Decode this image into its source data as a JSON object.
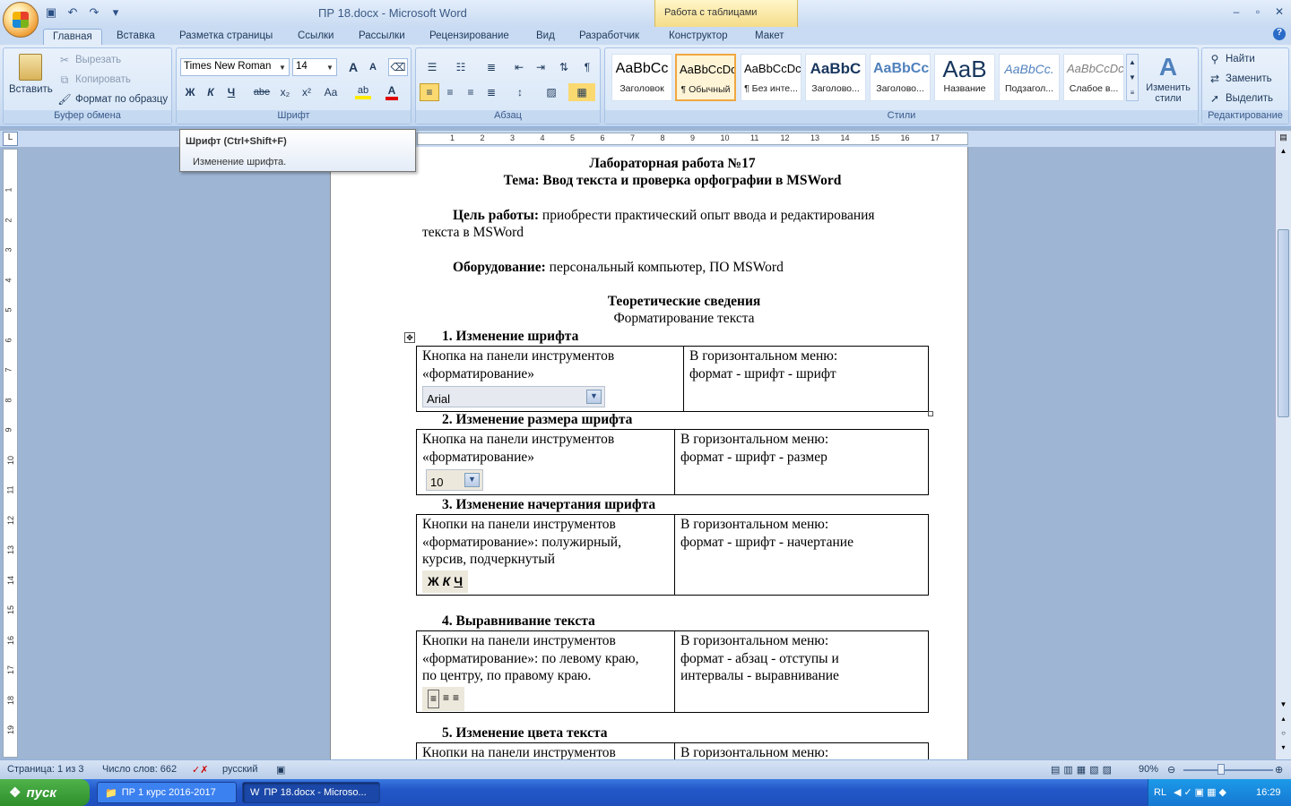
{
  "window": {
    "title": "ПР 18.docx - Microsoft Word",
    "context_tab": "Работа с таблицами"
  },
  "qat": {
    "save": "save-icon",
    "undo": "↶",
    "redo": "↷"
  },
  "tabs": [
    "Главная",
    "Вставка",
    "Разметка страницы",
    "Ссылки",
    "Рассылки",
    "Рецензирование",
    "Вид",
    "Разработчик",
    "Конструктор",
    "Макет"
  ],
  "clipboard": {
    "paste": "Вставить",
    "cut": "Вырезать",
    "copy": "Копировать",
    "format_painter": "Формат по образцу",
    "label": "Буфер обмена"
  },
  "font": {
    "family": "Times New Roman",
    "size": "14",
    "label": "Шрифт",
    "bold": "Ж",
    "italic": "К",
    "underline": "Ч",
    "strike": "abe",
    "sub": "x₂",
    "sup": "x²",
    "case": "Aa",
    "grow": "A",
    "shrink": "A"
  },
  "paragraph": {
    "label": "Абзац"
  },
  "styles": {
    "label": "Стили",
    "items": [
      {
        "preview": "AaBbCc",
        "name": "Заголовок"
      },
      {
        "preview": "AaBbCcDc",
        "name": "¶ Обычный"
      },
      {
        "preview": "AaBbCcDc",
        "name": "¶ Без инте..."
      },
      {
        "preview": "AaBbC",
        "name": "Заголово..."
      },
      {
        "preview": "AaBbCc",
        "name": "Заголово..."
      },
      {
        "preview": "AaB",
        "name": "Название"
      },
      {
        "preview": "AaBbCc.",
        "name": "Подзагол..."
      },
      {
        "preview": "AaBbCcDc",
        "name": "Слабое в..."
      }
    ],
    "change": "Изменить стили"
  },
  "editing": {
    "find": "Найти",
    "replace": "Заменить",
    "select": "Выделить",
    "label": "Редактирование"
  },
  "tooltip": {
    "title": "Шрифт (Ctrl+Shift+F)",
    "desc": "Изменение шрифта."
  },
  "ruler": {
    "marks": [
      "1",
      "2",
      "3",
      "4",
      "5",
      "6",
      "7",
      "8",
      "9",
      "10",
      "11",
      "12",
      "13",
      "14",
      "15",
      "16",
      "17"
    ],
    "vmarks": [
      "1",
      "2",
      "3",
      "4",
      "5",
      "6",
      "7",
      "8",
      "9",
      "10",
      "11",
      "12",
      "13",
      "14",
      "15",
      "16",
      "17",
      "18",
      "19"
    ]
  },
  "doc": {
    "title1": "Лабораторная работа №17",
    "title2": "Тема: Ввод текста и проверка орфографии в MSWord",
    "goal_label": "Цель работы:",
    "goal_text1": " приобрести практический опыт ввода и редактирования",
    "goal_text2": "текста в MSWord",
    "equip_label": "Оборудование:",
    "equip_text": " персональный компьютер, ПО MSWord",
    "theory": "Теоретические сведения",
    "formatting": "Форматирование текста",
    "s1": "1.  Изменение шрифта",
    "s2": "2.  Изменение размера шрифта",
    "s3": "3.  Изменение начертания шрифта",
    "s4": "4.  Выравнивание текста",
    "s5": "5.  Изменение цвета текста",
    "t1_left1": "Кнопка на панели инструментов",
    "t1_left2": "«форматирование»",
    "t1_combo": "Arial",
    "t1_right1": "В горизонтальном меню:",
    "t1_right2": "формат - шрифт - шрифт",
    "t2_left1": "Кнопка на панели инструментов",
    "t2_left2": "«форматирование»",
    "t2_combo": "10",
    "t2_right1": "В горизонтальном меню:",
    "t2_right2": " формат - шрифт  -  размер",
    "t3_left1": "Кнопки на панели инструментов",
    "t3_left2": "«форматирование»: полужирный,",
    "t3_left3": "курсив, подчеркнутый",
    "t3_right1": "В горизонтальном меню:",
    "t3_right2": "формат - шрифт - начертание",
    "t4_left1": "Кнопки на панели инструментов",
    "t4_left2": "«форматирование»: по левому краю,",
    "t4_left3": "по центру, по правому краю.",
    "t4_right1": "В горизонтальном меню:",
    "t4_right2": "формат - абзац  - отступы и",
    "t4_right3": "интервалы - выравнивание",
    "t5_left1": "Кнопки на панели инструментов",
    "t5_right1": "В горизонтальном меню:"
  },
  "status": {
    "page": "Страница: 1 из 3",
    "words": "Число слов: 662",
    "lang": "русский",
    "zoom": "90%"
  },
  "taskbar": {
    "start": "пуск",
    "task1": "ПР 1 курс 2016-2017",
    "task2": "ПР 18.docx - Microso...",
    "lang": "RL",
    "time": "16:29"
  }
}
